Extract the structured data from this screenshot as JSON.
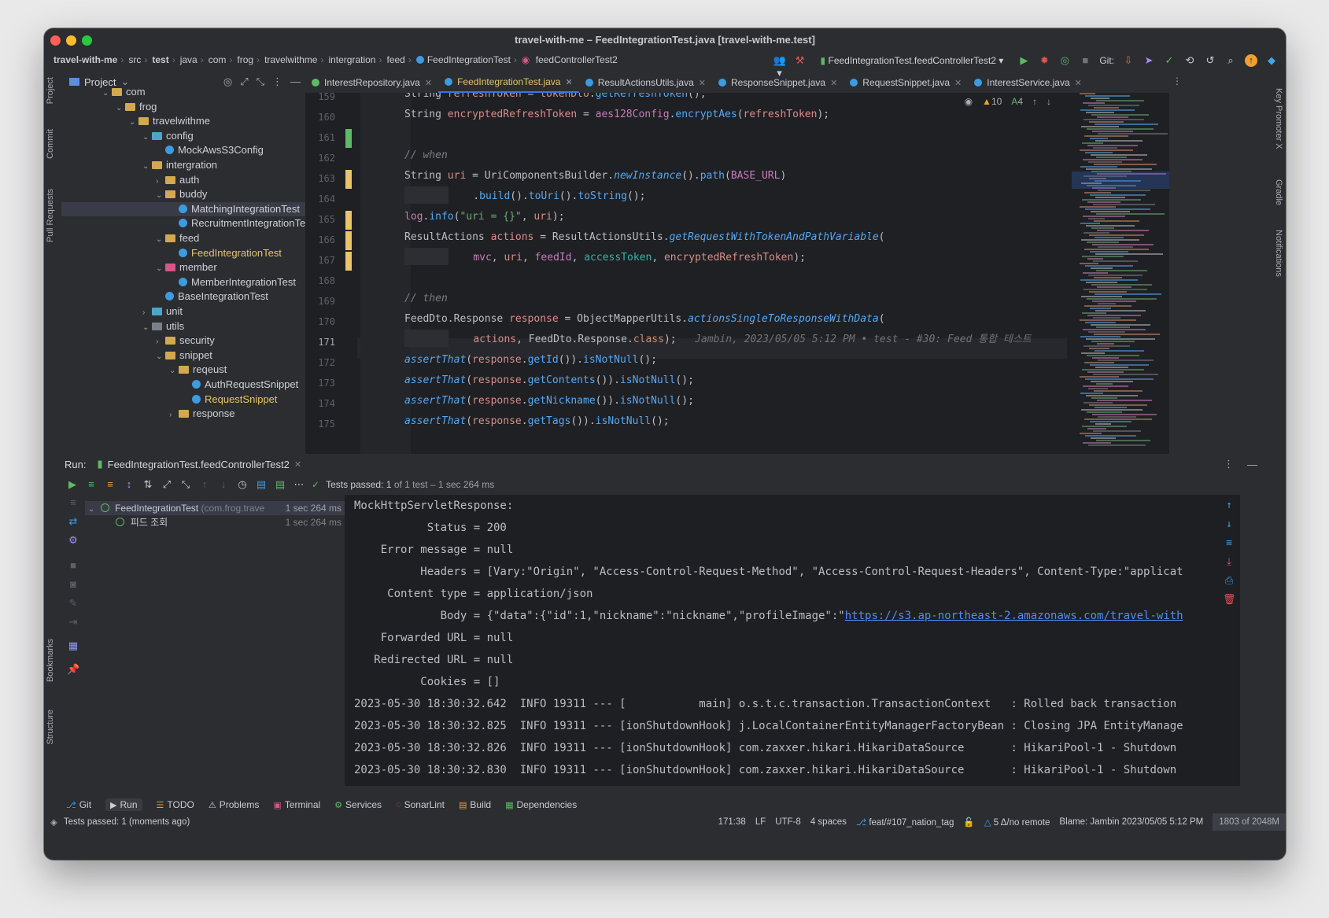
{
  "window": {
    "title": "travel-with-me – FeedIntegrationTest.java [travel-with-me.test]"
  },
  "breadcrumbs": [
    "travel-with-me",
    "src",
    "test",
    "java",
    "com",
    "frog",
    "travelwithme",
    "intergration",
    "feed",
    "FeedIntegrationTest",
    "feedControllerTest2"
  ],
  "navbar": {
    "run_config": "FeedIntegrationTest.feedControllerTest2",
    "git_label": "Git:"
  },
  "left_stripe": [
    "Project",
    "Commit",
    "Pull Requests",
    "Bookmarks",
    "Structure"
  ],
  "right_stripe": [
    "Key Promoter X",
    "Gradle",
    "Notifications"
  ],
  "project": {
    "title": "Project",
    "nodes": [
      {
        "label": "com",
        "depth": 0,
        "type": "folder",
        "open": true
      },
      {
        "label": "frog",
        "depth": 1,
        "type": "folder",
        "open": true
      },
      {
        "label": "travelwithme",
        "depth": 2,
        "type": "folder",
        "open": true
      },
      {
        "label": "config",
        "depth": 3,
        "type": "folder-teal",
        "open": true
      },
      {
        "label": "MockAwsS3Config",
        "depth": 4,
        "type": "class"
      },
      {
        "label": "intergration",
        "depth": 3,
        "type": "folder",
        "open": true
      },
      {
        "label": "auth",
        "depth": 4,
        "type": "folder",
        "open": false
      },
      {
        "label": "buddy",
        "depth": 4,
        "type": "folder",
        "open": true
      },
      {
        "label": "MatchingIntegrationTest",
        "depth": 5,
        "type": "class",
        "selected": true
      },
      {
        "label": "RecruitmentIntegrationTe",
        "depth": 5,
        "type": "class"
      },
      {
        "label": "feed",
        "depth": 4,
        "type": "folder",
        "open": true
      },
      {
        "label": "FeedIntegrationTest",
        "depth": 5,
        "type": "class",
        "highlight": true
      },
      {
        "label": "member",
        "depth": 4,
        "type": "folder-pink",
        "open": true
      },
      {
        "label": "MemberIntegrationTest",
        "depth": 5,
        "type": "class"
      },
      {
        "label": "BaseIntegrationTest",
        "depth": 4,
        "type": "class"
      },
      {
        "label": "unit",
        "depth": 3,
        "type": "folder-teal",
        "open": false
      },
      {
        "label": "utils",
        "depth": 3,
        "type": "folder-gray",
        "open": true
      },
      {
        "label": "security",
        "depth": 4,
        "type": "folder",
        "open": false
      },
      {
        "label": "snippet",
        "depth": 4,
        "type": "folder",
        "open": true
      },
      {
        "label": "reqeust",
        "depth": 5,
        "type": "folder",
        "open": true
      },
      {
        "label": "AuthRequestSnippet",
        "depth": 6,
        "type": "class"
      },
      {
        "label": "RequestSnippet",
        "depth": 6,
        "type": "class",
        "highlight": true
      },
      {
        "label": "response",
        "depth": 5,
        "type": "folder",
        "open": false
      }
    ]
  },
  "tabs": [
    {
      "label": "InterestRepository.java",
      "active": false,
      "icon": "interface-icon"
    },
    {
      "label": "FeedIntegrationTest.java",
      "active": true,
      "icon": "class-icon"
    },
    {
      "label": "ResultActionsUtils.java",
      "active": false,
      "icon": "class-icon"
    },
    {
      "label": "ResponseSnippet.java",
      "active": false,
      "icon": "class-icon"
    },
    {
      "label": "RequestSnippet.java",
      "active": false,
      "icon": "class-icon"
    },
    {
      "label": "InterestService.java",
      "active": false,
      "icon": "class-icon"
    }
  ],
  "editor": {
    "inspections": {
      "warnings": "10",
      "typos": "4"
    },
    "line_numbers": [
      "159",
      "160",
      "161",
      "162",
      "163",
      "164",
      "165",
      "166",
      "167",
      "168",
      "169",
      "170",
      "171",
      "172",
      "173",
      "174",
      "175"
    ],
    "current_line": "171",
    "blame": "Jambin, 2023/05/05 5:12 PM • test - #30: Feed 통합 테스트"
  },
  "run": {
    "label": "Run:",
    "tab": "FeedIntegrationTest.feedControllerTest2",
    "status_prefix": "Tests passed:",
    "status_count": "1",
    "status_suffix": "of 1 test – 1 sec 264 ms",
    "tree": [
      {
        "label": "FeedIntegrationTest",
        "package": "(com.frog.trave",
        "time": "1 sec 264 ms"
      },
      {
        "label": "피드 조회",
        "time": "1 sec 264 ms"
      }
    ],
    "console": [
      "MockHttpServletResponse:",
      "           Status = 200",
      "    Error message = null",
      "          Headers = [Vary:\"Origin\", \"Access-Control-Request-Method\", \"Access-Control-Request-Headers\", Content-Type:\"applicat",
      "     Content type = application/json",
      "             Body = {\"data\":{\"id\":1,\"nickname\":\"nickname\",\"profileImage\":\"",
      "    Forwarded URL = null",
      "   Redirected URL = null",
      "          Cookies = []",
      "2023-05-30 18:30:32.642  INFO 19311 --- [           main] o.s.t.c.transaction.TransactionContext   : Rolled back transaction",
      "2023-05-30 18:30:32.825  INFO 19311 --- [ionShutdownHook] j.LocalContainerEntityManagerFactoryBean : Closing JPA EntityManage",
      "2023-05-30 18:30:32.826  INFO 19311 --- [ionShutdownHook] com.zaxxer.hikari.HikariDataSource       : HikariPool-1 - Shutdown",
      "2023-05-30 18:30:32.830  INFO 19311 --- [ionShutdownHook] com.zaxxer.hikari.HikariDataSource       : HikariPool-1 - Shutdown"
    ],
    "body_link": "https://s3.ap-northeast-2.amazonaws.com/travel-with"
  },
  "bottom_tools": [
    "Git",
    "Run",
    "TODO",
    "Problems",
    "Terminal",
    "Services",
    "SonarLint",
    "Build",
    "Dependencies"
  ],
  "status": {
    "message": "Tests passed: 1 (moments ago)",
    "position": "171:38",
    "line_sep": "LF",
    "encoding": "UTF-8",
    "indent": "4 spaces",
    "branch": "feat/#107_nation_tag",
    "changes": "5 Δ/no remote",
    "blame": "Blame: Jambin 2023/05/05 5:12 PM",
    "memory": "1803 of 2048M"
  },
  "colors": {
    "accent": "#3574f0",
    "pass": "#5fb865",
    "folder": "#d2a850"
  }
}
